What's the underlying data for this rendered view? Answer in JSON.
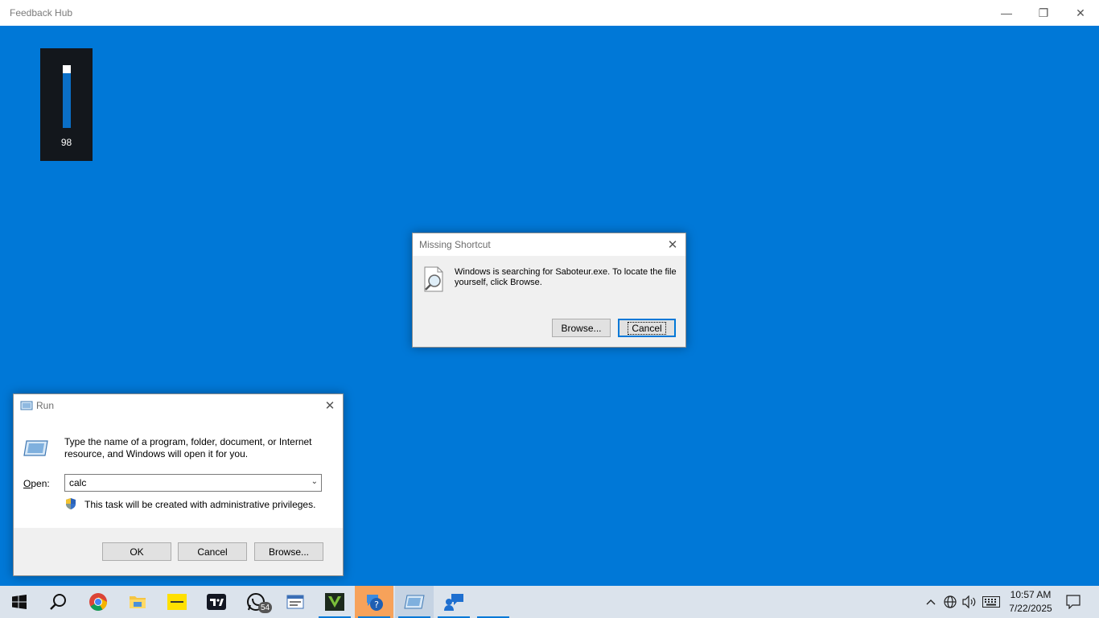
{
  "app": {
    "title": "Feedback Hub",
    "minimize_icon": "—",
    "restore_icon": "❐",
    "close_icon": "✕"
  },
  "volume": {
    "value": "98",
    "level_fraction": 0.98
  },
  "missing_shortcut": {
    "title": "Missing Shortcut",
    "message": "Windows is searching for Saboteur.exe. To locate the file yourself, click Browse.",
    "browse_label": "Browse...",
    "cancel_label": "Cancel"
  },
  "run_dialog": {
    "title": "Run",
    "message": "Type the name of a program, folder, document, or Internet resource, and Windows will open it for you.",
    "open_label_accel": "O",
    "open_label_rest": "pen:",
    "open_value": "calc",
    "admin_note": "This task will be created with administrative privileges.",
    "ok_label": "OK",
    "cancel_label": "Cancel",
    "browse_label": "Browse..."
  },
  "taskbar": {
    "whatsapp_badge": "54",
    "clock_time": "10:57 AM",
    "clock_date": "7/22/2025",
    "tray_chevron": "^",
    "colors": {
      "accent": "#0078d7",
      "highlight": "#f7a25a"
    }
  }
}
